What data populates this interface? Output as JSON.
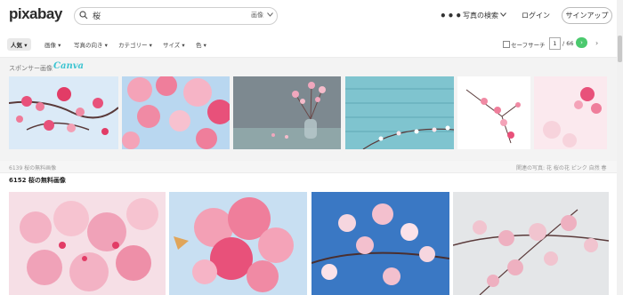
{
  "header": {
    "logo": "pixabay",
    "search_query": "桜",
    "search_type": "画像",
    "dots": "•••",
    "explore": "写真の検索",
    "login": "ログイン",
    "signup": "サインアップ"
  },
  "filters": {
    "popular": "人気",
    "items": [
      "画像",
      "写真の向き",
      "カテゴリー",
      "サイズ",
      "色"
    ],
    "safe_search": "セーフサーチ",
    "page": "1",
    "total": "/ 66"
  },
  "sponsor": {
    "label": "スポンサー画像",
    "brand": "Canva"
  },
  "results": {
    "stats": "6139 桜の無料画像",
    "related": "関連の写真: 花 桜の花 ピンク 自然 春",
    "title": "6152 桜の無料画像"
  },
  "colors": {
    "accent_green": "#4bc96e",
    "canva": "#3cc4d1",
    "sky": "#c8dff2",
    "blossom": "#e8517a",
    "teal_wood": "#7fc4cf"
  },
  "icons": {
    "search": "search-icon",
    "chevron": "chevron-down-icon"
  }
}
